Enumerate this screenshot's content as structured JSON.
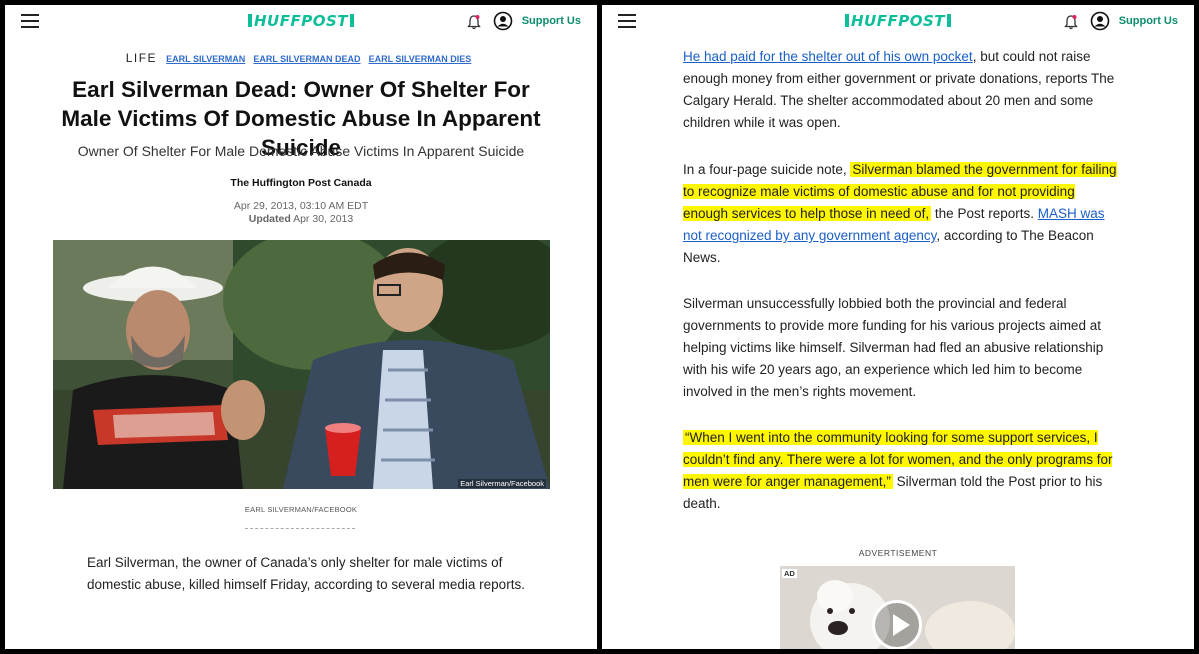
{
  "header": {
    "logo_text": "HUFFPOST",
    "support_label": "Support Us",
    "brand_color": "#0dbe98"
  },
  "left": {
    "section": "LIFE",
    "tags": [
      "EARL SILVERMAN",
      "EARL SILVERMAN DEAD",
      "EARL SILVERMAN DIES"
    ],
    "headline": "Earl Silverman Dead: Owner Of Shelter For Male Victims Of Domestic Abuse In Apparent Suicide",
    "dek": "Owner Of Shelter For Male Domestic Abuse Victims In Apparent Suicide",
    "byline": "The Huffington Post Canada",
    "published": "Apr 29, 2013, 03:10 AM EDT",
    "updated_label": "Updated",
    "updated": "Apr 30, 2013",
    "photo_watermark": "Earl Silverman/Facebook",
    "caption": "EARL SILVERMAN/FACEBOOK",
    "body": "Earl Silverman, the owner of Canada’s only shelter for male victims of domestic abuse, killed himself Friday, according to several media reports."
  },
  "right": {
    "p1_link": "He had paid for the shelter out of his own pocket",
    "p1_rest": ", but could not raise enough money from either government or private donations, reports The Calgary Herald. The shelter accommodated about 20 men and some children while it was open.",
    "p2_start": "In a four-page suicide note, ",
    "p2_highlight": "Silverman blamed the government for failing to recognize male victims of domestic abuse and for not providing enough services to help those in need of,",
    "p2_mid": " the Post reports. ",
    "p2_link": "MASH was not recognized by any government agency",
    "p2_end": ", according to The Beacon News.",
    "p3": "Silverman unsuccessfully lobbied both the provincial and federal governments to provide more funding for his various projects aimed at helping victims like himself. Silverman had fled an abusive relationship with his wife 20 years ago, an experience which led him to become involved in the men’s rights movement.",
    "p4_highlight": "“When I went into the community looking for some support services, I couldn’t find any. There were a lot for women, and the only programs for men were for anger management,”",
    "p4_end": " Silverman told the Post prior to his death.",
    "ad_label": "ADVERTISEMENT",
    "ad_badge": "AD",
    "highlight_color": "#fff700"
  }
}
